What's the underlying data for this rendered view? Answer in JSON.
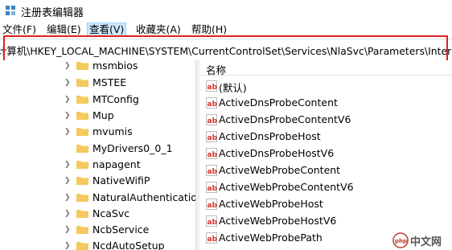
{
  "window": {
    "title": "注册表编辑器"
  },
  "menu": {
    "items": [
      {
        "label": "文件(F)"
      },
      {
        "label": "编辑(E)"
      },
      {
        "label": "查看(V)"
      },
      {
        "label": "收藏夹(A)"
      },
      {
        "label": "帮助(H)"
      }
    ],
    "active_index": 2
  },
  "address": {
    "path": "计算机\\HKEY_LOCAL_MACHINE\\SYSTEM\\CurrentControlSet\\Services\\NlaSvc\\Parameters\\Internet"
  },
  "tree": {
    "items": [
      {
        "label": "msmbios"
      },
      {
        "label": "MSTEE"
      },
      {
        "label": "MTConfig"
      },
      {
        "label": "Mup"
      },
      {
        "label": "mvumis"
      },
      {
        "label": "MyDrivers0_0_1"
      },
      {
        "label": "napagent"
      },
      {
        "label": "NativeWifiP"
      },
      {
        "label": "NaturalAuthentication"
      },
      {
        "label": "NcaSvc"
      },
      {
        "label": "NcbService"
      },
      {
        "label": "NcdAutoSetup"
      }
    ]
  },
  "values_pane": {
    "column_name": "名称",
    "rows": [
      {
        "name": "(默认)"
      },
      {
        "name": "ActiveDnsProbeContent"
      },
      {
        "name": "ActiveDnsProbeContentV6"
      },
      {
        "name": "ActiveDnsProbeHost"
      },
      {
        "name": "ActiveDnsProbeHostV6"
      },
      {
        "name": "ActiveWebProbeContent"
      },
      {
        "name": "ActiveWebProbeContentV6"
      },
      {
        "name": "ActiveWebProbeHost"
      },
      {
        "name": "ActiveWebProbeHostV6"
      },
      {
        "name": "ActiveWebProbePath"
      }
    ]
  },
  "watermark": {
    "text": "中文网"
  },
  "colors": {
    "highlight": "#e02020",
    "menu_active": "#cce8ff",
    "folder": "#f4c95d",
    "ab_icon": "#d6332b"
  }
}
